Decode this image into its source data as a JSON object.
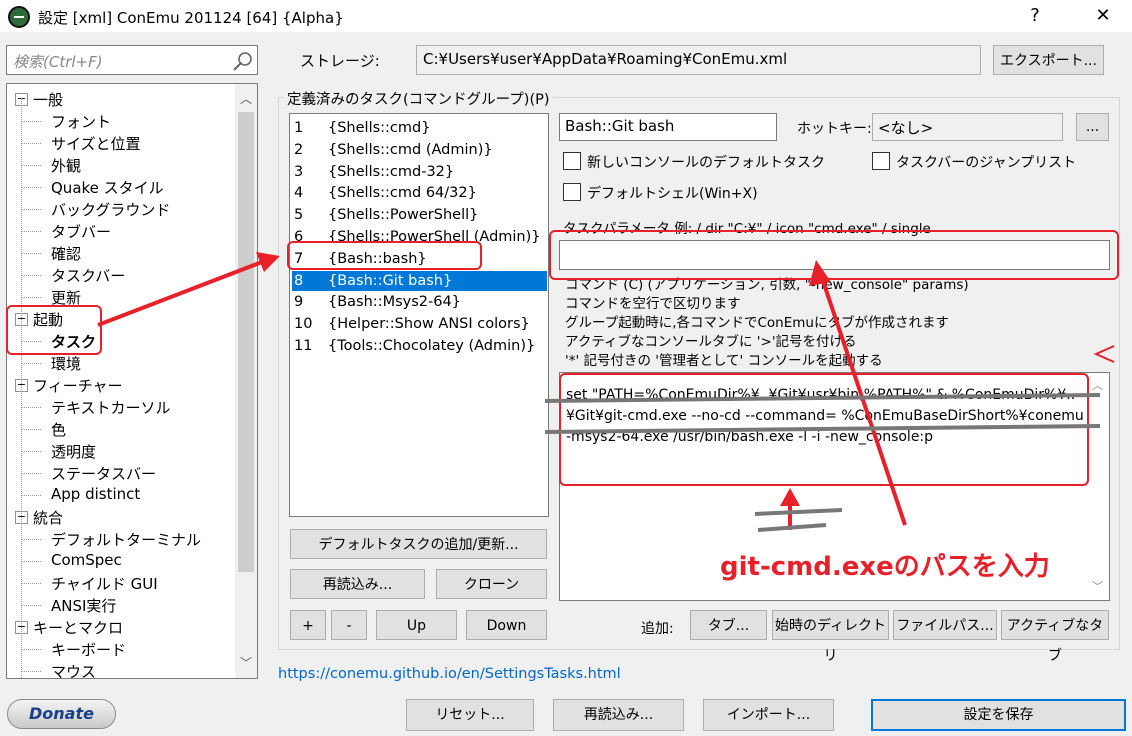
{
  "window": {
    "title": "設定 [xml] ConEmu 201124 [64] {Alpha}",
    "help": "?",
    "close": "✕"
  },
  "search": {
    "placeholder": "検索(Ctrl+F)"
  },
  "tree": [
    {
      "label": "一般",
      "level": 0,
      "exp": "⊟"
    },
    {
      "label": "フォント",
      "level": 1
    },
    {
      "label": "サイズと位置",
      "level": 1
    },
    {
      "label": "外観",
      "level": 1
    },
    {
      "label": "Quake スタイル",
      "level": 1
    },
    {
      "label": "バックグラウンド",
      "level": 1
    },
    {
      "label": "タブバー",
      "level": 1
    },
    {
      "label": "確認",
      "level": 1
    },
    {
      "label": "タスクバー",
      "level": 1
    },
    {
      "label": "更新",
      "level": 1
    },
    {
      "label": "起動",
      "level": 0,
      "exp": "⊟"
    },
    {
      "label": "タスク",
      "level": 1,
      "bold": true
    },
    {
      "label": "環境",
      "level": 1
    },
    {
      "label": "フィーチャー",
      "level": 0,
      "exp": "⊟"
    },
    {
      "label": "テキストカーソル",
      "level": 1
    },
    {
      "label": "色",
      "level": 1
    },
    {
      "label": "透明度",
      "level": 1
    },
    {
      "label": "ステータスバー",
      "level": 1
    },
    {
      "label": "App distinct",
      "level": 1
    },
    {
      "label": "統合",
      "level": 0,
      "exp": "⊟"
    },
    {
      "label": "デフォルトターミナル",
      "level": 1
    },
    {
      "label": "ComSpec",
      "level": 1
    },
    {
      "label": "チャイルド GUI",
      "level": 1
    },
    {
      "label": "ANSI実行",
      "level": 1
    },
    {
      "label": "キーとマクロ",
      "level": 0,
      "exp": "⊟"
    },
    {
      "label": "キーボード",
      "level": 1
    },
    {
      "label": "マウス",
      "level": 1
    }
  ],
  "storage": {
    "label": "ストレージ:",
    "path": "C:¥Users¥user¥AppData¥Roaming¥ConEmu.xml",
    "export": "エクスポート..."
  },
  "tasks": {
    "group_label": "定義済みのタスク(コマンドグループ)(P)",
    "items": [
      {
        "num": "1",
        "name": "{Shells::cmd}"
      },
      {
        "num": "2",
        "name": "{Shells::cmd (Admin)}"
      },
      {
        "num": "3",
        "name": "{Shells::cmd-32}"
      },
      {
        "num": "4",
        "name": "{Shells::cmd 64/32}"
      },
      {
        "num": "5",
        "name": "{Shells::PowerShell}"
      },
      {
        "num": "6",
        "name": "{Shells::PowerShell (Admin)}"
      },
      {
        "num": "7",
        "name": "{Bash::bash}"
      },
      {
        "num": "8",
        "name": "{Bash::Git bash}",
        "selected": true
      },
      {
        "num": "9",
        "name": "{Bash::Msys2-64}"
      },
      {
        "num": "10",
        "name": "{Helper::Show ANSI colors}"
      },
      {
        "num": "11",
        "name": "{Tools::Chocolatey (Admin)}"
      }
    ],
    "add_default": "デフォルトタスクの追加/更新...",
    "reload": "再読込み...",
    "clone": "クローン",
    "plus": "+",
    "minus": "-",
    "up": "Up",
    "down": "Down"
  },
  "detail": {
    "task_name": "Bash::Git bash",
    "hotkey_label": "ホットキー:",
    "hotkey_value": "<なし>",
    "hotkey_btn": "...",
    "chk_default_console": "新しいコンソールのデフォルトタスク",
    "chk_taskbar_jump": "タスクバーのジャンプリスト",
    "chk_default_shell": "デフォルトシェル(Win+X)",
    "params_label": "タスクパラメータ 例: / dir \"C:¥\" / icon \"cmd.exe\" / single",
    "params_value": "",
    "help_lines": [
      "コマンド (C) (アプリケーション, 引数, \"-new_console\" params)",
      "コマンドを空行で区切ります",
      "グループ起動時に,各コマンドでConEmuにタブが作成されます",
      "アクティブなコンソールタブに '>'記号を付ける",
      "'*' 記号付きの '管理者として' コンソールを起動する"
    ],
    "commands": "set \"PATH=%ConEmuDir%¥..¥Git¥usr¥bin;%PATH%\" & %ConEmuDir%¥..¥Git¥git-cmd.exe --no-cd --command= %ConEmuBaseDirShort%¥conemu-msys2-64.exe /usr/bin/bash.exe -l -i -new_console:p",
    "add_label": "追加:",
    "add_tab": "タブ...",
    "add_startdir": "始時のディレクトリ",
    "add_filepath": "ファイルパス...",
    "add_activetab": "アクティブなタブ"
  },
  "annotation": {
    "text": "git-cmd.exeのパスを入力"
  },
  "footer": {
    "link": "https://conemu.github.io/en/SettingsTasks.html",
    "donate": "Donate",
    "reset": "リセット...",
    "reload": "再読込み...",
    "import": "インポート...",
    "save": "設定を保存"
  },
  "colors": {
    "accent": "#0078d7",
    "annotation": "#e8202a",
    "link": "#0066cc"
  }
}
